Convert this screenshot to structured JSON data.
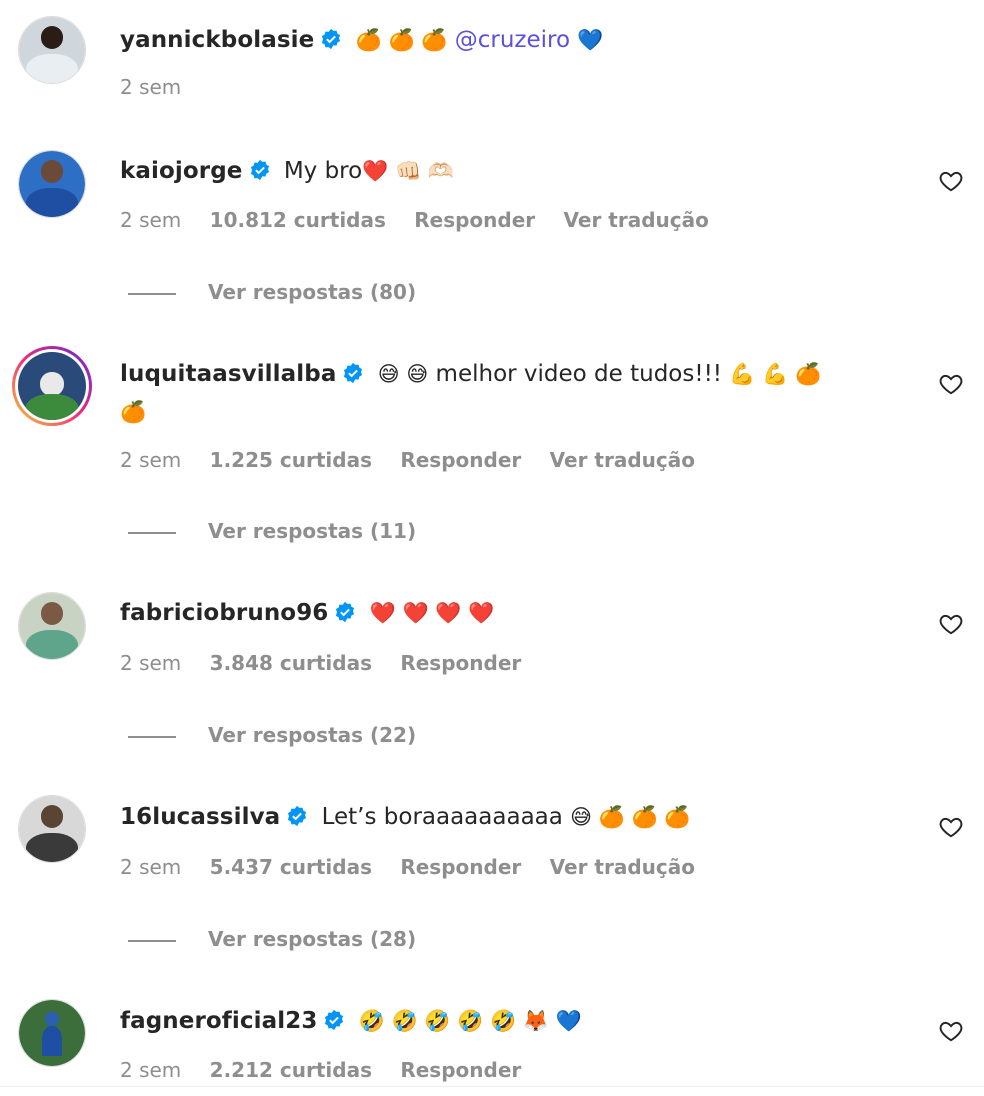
{
  "colors": {
    "text": "#262626",
    "secondary": "#8e8e8e",
    "mention": "#5b51d8",
    "verified": "#0095f6"
  },
  "icons": {
    "verified": "verified-badge-icon",
    "like": "heart-outline-icon"
  },
  "comments": [
    {
      "username": "yannickbolasie",
      "emojis_pre": "🍊 🍊 🍊",
      "mention": "@cruzeiro",
      "emojis_post": "💙",
      "time": "2 sem"
    },
    {
      "username": "kaiojorge",
      "text": "My bro",
      "emojis": "❤️ 👊🏻 🫶🏻",
      "time": "2 sem",
      "likes": "10.812 curtidas",
      "reply": "Responder",
      "translate": "Ver tradução",
      "replies": "Ver respostas (80)"
    },
    {
      "username": "luquitaasvillalba",
      "emojis_pre": "😅 😅",
      "text": "melhor video de tudos!!!",
      "emojis": "💪 💪 🍊",
      "emojis_line2": "🍊",
      "time": "2 sem",
      "likes": "1.225 curtidas",
      "reply": "Responder",
      "translate": "Ver tradução",
      "replies": "Ver respostas (11)"
    },
    {
      "username": "fabriciobruno96",
      "emojis": "❤️ ❤️ ❤️ ❤️",
      "time": "2 sem",
      "likes": "3.848 curtidas",
      "reply": "Responder",
      "replies": "Ver respostas (22)"
    },
    {
      "username": "16lucassilva",
      "text": "Let’s boraaaaaaaaaa",
      "emojis": "😅  🍊 🍊 🍊",
      "time": "2 sem",
      "likes": "5.437 curtidas",
      "reply": "Responder",
      "translate": "Ver tradução",
      "replies": "Ver respostas (28)"
    },
    {
      "username": "fagneroficial23",
      "emojis": "🤣 🤣 🤣 🤣 🤣 🦊 💙",
      "time": "2 sem",
      "likes": "2.212 curtidas",
      "reply": "Responder"
    }
  ]
}
